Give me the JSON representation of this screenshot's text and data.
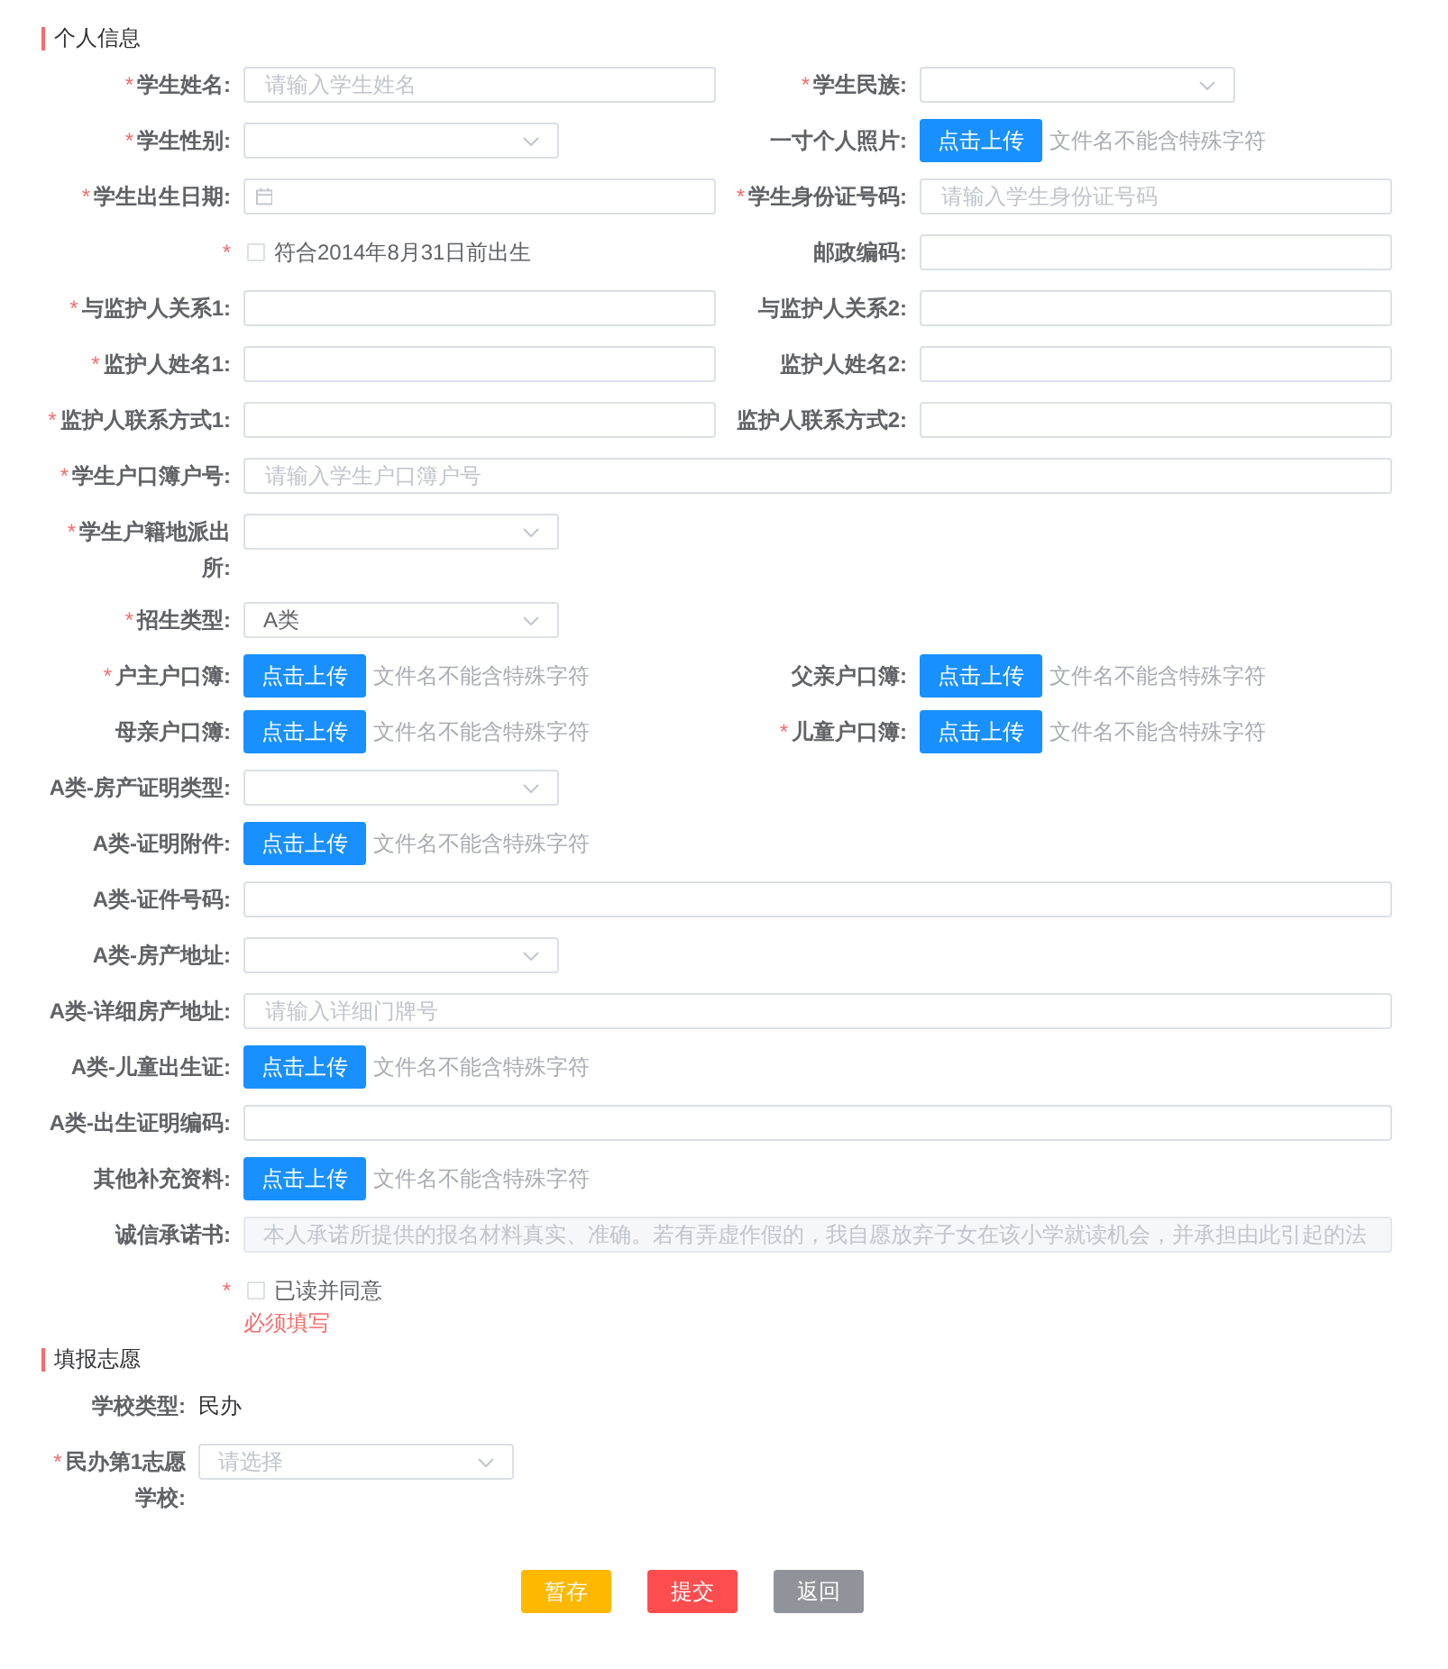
{
  "sections": [
    {
      "title": "个人信息",
      "kind": "two-column",
      "rows": [
        {
          "items": [
            {
              "kind": "input",
              "label": "学生姓名:",
              "required_mark": "*",
              "placeholder": "请输入学生姓名"
            },
            {
              "kind": "select",
              "label": "学生民族:",
              "required_mark": "*"
            }
          ]
        },
        {
          "items": [
            {
              "kind": "select",
              "label": "学生性别:",
              "required_mark": "*"
            },
            {
              "kind": "upload",
              "label": "一寸个人照片:",
              "button": "点击上传",
              "hint": "文件名不能含特殊字符"
            }
          ]
        },
        {
          "items": [
            {
              "kind": "date",
              "label": "学生出生日期:",
              "required_mark": "*"
            },
            {
              "kind": "input",
              "label": "学生身份证号码:",
              "required_mark": "*",
              "placeholder": "请输入学生身份证号码"
            }
          ]
        },
        {
          "items": [
            {
              "kind": "checkbox",
              "required_mark": "*",
              "checked": false,
              "text": "符合2014年8月31日前出生"
            },
            {
              "kind": "input",
              "label": "邮政编码:"
            }
          ]
        },
        {
          "items": [
            {
              "kind": "input",
              "label": "与监护人关系1:",
              "required_mark": "*"
            },
            {
              "kind": "input",
              "label": "与监护人关系2:"
            }
          ]
        },
        {
          "items": [
            {
              "kind": "input",
              "label": "监护人姓名1:",
              "required_mark": "*"
            },
            {
              "kind": "input",
              "label": "监护人姓名2:"
            }
          ]
        },
        {
          "items": [
            {
              "kind": "input",
              "label": "监护人联系方式1:",
              "required_mark": "*"
            },
            {
              "kind": "input",
              "label": "监护人联系方式2:"
            }
          ]
        },
        {
          "items": [
            {
              "kind": "input",
              "label": "学生户口簿户号:",
              "required_mark": "*",
              "placeholder": "请输入学生户口簿户号"
            }
          ]
        },
        {
          "items": [
            {
              "kind": "select",
              "label": "学生户籍地派出所:",
              "required_mark": "*"
            }
          ]
        },
        {
          "items": [
            {
              "kind": "select",
              "label": "招生类型:",
              "required_mark": "*",
              "value": "A类"
            }
          ]
        },
        {
          "items": [
            {
              "kind": "upload",
              "label": "户主户口簿:",
              "required_mark": "*",
              "button": "点击上传",
              "hint": "文件名不能含特殊字符"
            },
            {
              "kind": "upload",
              "label": "父亲户口簿:",
              "button": "点击上传",
              "hint": "文件名不能含特殊字符"
            }
          ]
        },
        {
          "items": [
            {
              "kind": "upload",
              "label": "母亲户口簿:",
              "button": "点击上传",
              "hint": "文件名不能含特殊字符"
            },
            {
              "kind": "upload",
              "label": "儿童户口簿:",
              "required_mark": "*",
              "button": "点击上传",
              "hint": "文件名不能含特殊字符"
            }
          ]
        },
        {
          "items": [
            {
              "kind": "select",
              "label": "A类-房产证明类型:"
            }
          ]
        },
        {
          "items": [
            {
              "kind": "upload",
              "label": "A类-证明附件:",
              "button": "点击上传",
              "hint": "文件名不能含特殊字符"
            }
          ]
        },
        {
          "items": [
            {
              "kind": "input",
              "label": "A类-证件号码:"
            }
          ]
        },
        {
          "items": [
            {
              "kind": "select",
              "label": "A类-房产地址:"
            }
          ]
        },
        {
          "items": [
            {
              "kind": "input",
              "label": "A类-详细房产地址:",
              "placeholder": "请输入详细门牌号"
            }
          ]
        },
        {
          "items": [
            {
              "kind": "upload",
              "label": "A类-儿童出生证:",
              "button": "点击上传",
              "hint": "文件名不能含特殊字符"
            }
          ]
        },
        {
          "items": [
            {
              "kind": "input",
              "label": "A类-出生证明编码:"
            }
          ]
        },
        {
          "items": [
            {
              "kind": "upload",
              "label": "其他补充资料:",
              "button": "点击上传",
              "hint": "文件名不能含特殊字符"
            }
          ]
        },
        {
          "items": [
            {
              "kind": "input",
              "label": "诚信承诺书:",
              "disabled": true,
              "placeholder": "本人承诺所提供的报名材料真实、准确。若有弄虚作假的，我自愿放弃子女在该小学就读机会，并承担由此引起的法"
            }
          ]
        },
        {
          "items": [
            {
              "kind": "checkbox",
              "required_mark": "*",
              "checked": false,
              "text": "已读并同意",
              "error": "必须填写"
            }
          ]
        }
      ]
    },
    {
      "title": "填报志愿",
      "kind": "single-column",
      "rows": [
        {
          "items": [
            {
              "kind": "text",
              "label": "学校类型:",
              "value": "民办"
            }
          ]
        },
        {
          "items": [
            {
              "kind": "select",
              "label": "民办第1志愿学校:",
              "required_mark": "*",
              "placeholder": "请选择"
            }
          ]
        }
      ]
    }
  ],
  "buttons": [
    {
      "label": "暂存",
      "kind": "warning"
    },
    {
      "label": "提交",
      "kind": "danger"
    },
    {
      "label": "返回",
      "kind": "info"
    }
  ]
}
